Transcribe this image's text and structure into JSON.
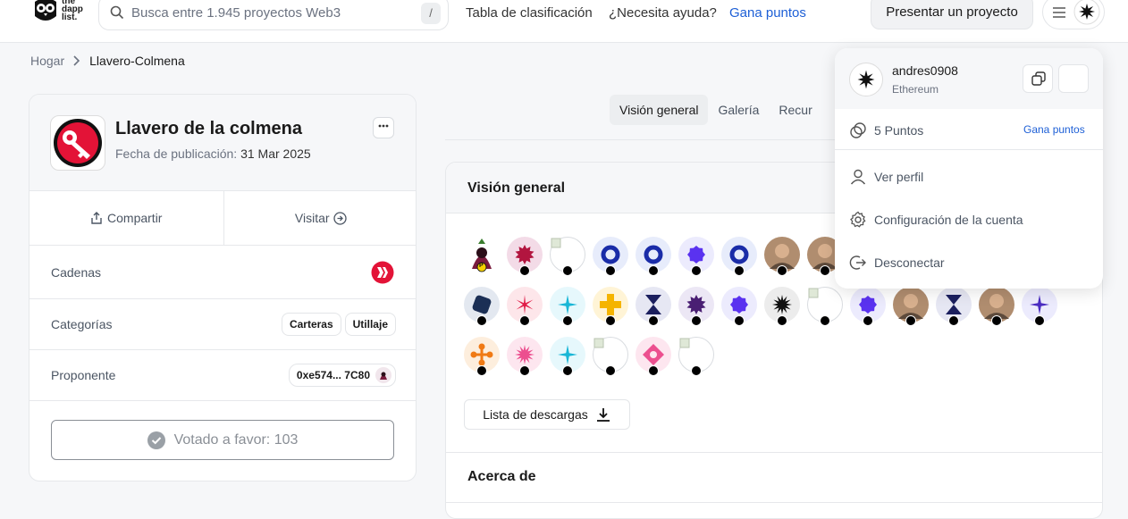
{
  "header": {
    "logo_text": [
      "the",
      "dapp",
      "list."
    ],
    "search_placeholder": "Busca entre 1.945 proyectos Web3",
    "search_shortcut": "/",
    "nav": [
      "Tabla de clasificación",
      "¿Necesita ayuda?",
      "Gana puntos"
    ],
    "submit_label": "Presentar un proyecto"
  },
  "breadcrumb": {
    "home": "Hogar",
    "current": "Llavero-Colmena"
  },
  "project": {
    "title": "Llavero de la colmena",
    "date_label": "Fecha de publicación:",
    "date_value": "31 Mar 2025",
    "share_label": "Compartir",
    "visit_label": "Visitar",
    "chains_label": "Cadenas",
    "categories_label": "Categorías",
    "categories": [
      "Carteras",
      "Utillaje"
    ],
    "proposer_label": "Proponente",
    "proposer_address": "0xe574... 7C80",
    "vote_label": "Votado a favor: 103"
  },
  "tabs": [
    "Visión general",
    "Galería",
    "Recur"
  ],
  "overview": {
    "title": "Visión general",
    "download_label": "Lista de descargas",
    "about_title": "Acerca de",
    "avatar_marks": [
      "P"
    ]
  },
  "account_menu": {
    "username": "andres0908",
    "chain": "Ethereum",
    "points": "5 Puntos",
    "earn": "Gana puntos",
    "items": [
      "Ver perfil",
      "Configuración de la cuenta",
      "Desconectar"
    ]
  },
  "colors": {
    "accent_blue": "#1d5fd6",
    "hive_red": "#e31337",
    "border": "#e6e8eb"
  }
}
